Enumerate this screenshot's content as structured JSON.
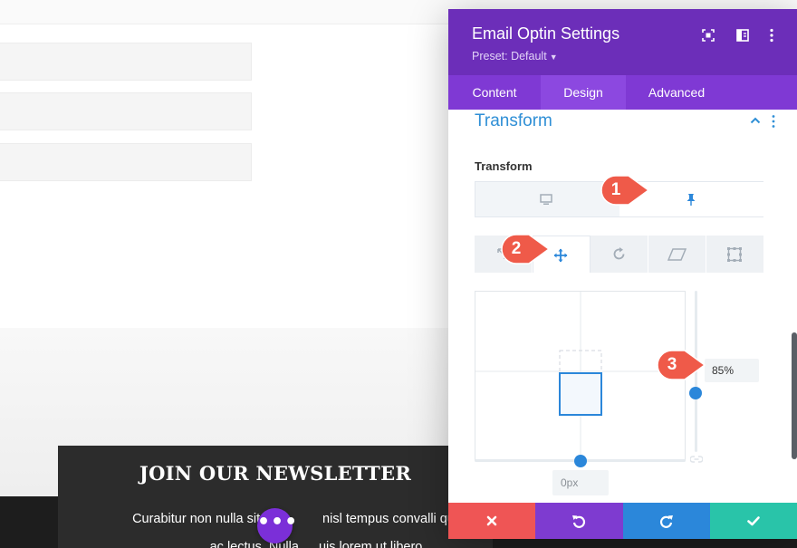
{
  "newsletter": {
    "title": "JOIN OUR NEWSLETTER",
    "line1": "Curabitur non nulla sit ar",
    "line1_end": "nisl tempus convalli qu",
    "line2": "ac lectus. Nulla",
    "line2_end": "uis lorem ut libero"
  },
  "builder": {
    "more_label": "•••"
  },
  "modal": {
    "title": "Email Optin Settings",
    "preset": "Preset: Default",
    "header_icons": [
      "focus-icon",
      "split-view-icon",
      "kebab-icon"
    ],
    "tabs": [
      {
        "label": "Content",
        "active": false
      },
      {
        "label": "Design",
        "active": true
      },
      {
        "label": "Advanced",
        "active": false
      }
    ],
    "section_title": "Transform",
    "field_label": "Transform",
    "devices": [
      "desktop-icon",
      "hover-pin-icon"
    ],
    "tools": [
      "scale-icon",
      "translate-icon",
      "rotate-icon",
      "skew-icon",
      "origin-icon"
    ],
    "translate_y_value": "85%",
    "translate_x_value": "0px",
    "footer": [
      "close-icon",
      "undo-icon",
      "redo-icon",
      "check-icon"
    ]
  },
  "annotations": [
    {
      "number": "1"
    },
    {
      "number": "2"
    },
    {
      "number": "3"
    }
  ],
  "colors": {
    "purple_header": "#6c2eb9",
    "tab_bar": "#7f39d4",
    "accent_blue": "#2b87da",
    "callout_red": "#ef5a49",
    "cancel_red": "#ef5555",
    "save_teal": "#29c4a9"
  }
}
